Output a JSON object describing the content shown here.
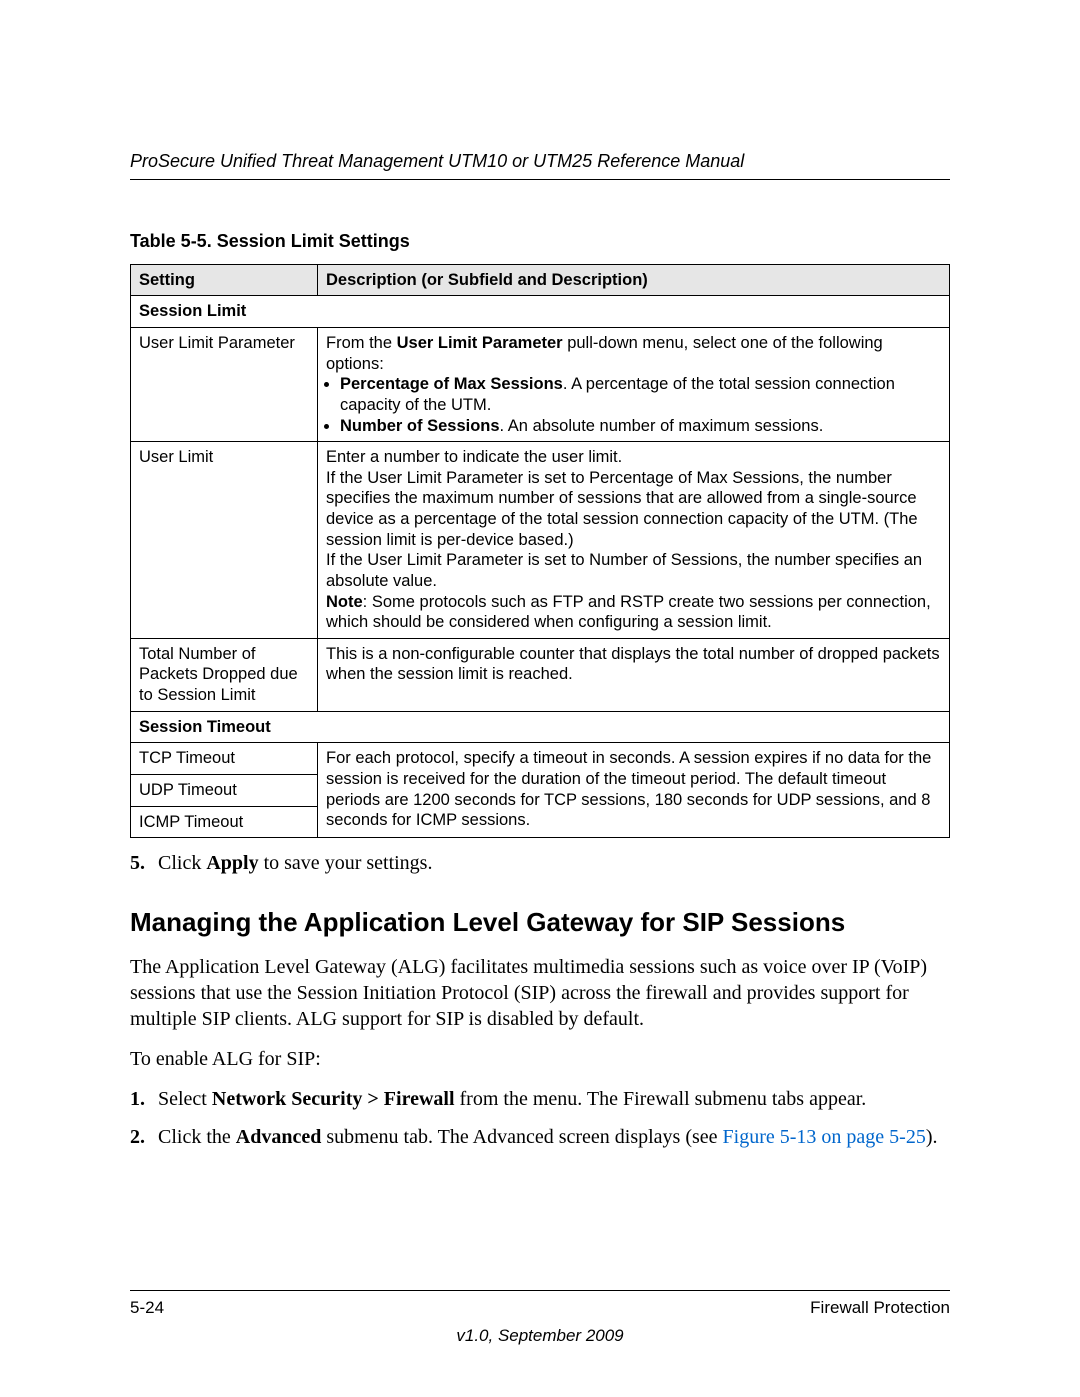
{
  "header": {
    "running_head": "ProSecure Unified Threat Management UTM10 or UTM25 Reference Manual"
  },
  "table": {
    "caption": "Table 5-5. Session Limit Settings",
    "col_setting": "Setting",
    "col_desc": "Description (or Subfield and Description)",
    "section1": "Session Limit",
    "row1_setting": "User Limit Parameter",
    "row1_desc_intro_1": "From the ",
    "row1_desc_intro_bold": "User Limit Parameter",
    "row1_desc_intro_2": " pull-down menu, select one of the following options:",
    "row1_b1_bold": "Percentage of Max Sessions",
    "row1_b1_rest": ". A percentage of the total session connection capacity of the UTM.",
    "row1_b2_bold": "Number of Sessions",
    "row1_b2_rest": ". An absolute number of maximum sessions.",
    "row2_setting": "User Limit",
    "row2_l1": "Enter a number to indicate the user limit.",
    "row2_l2": "If the User Limit Parameter is set to Percentage of Max Sessions, the number specifies the maximum number of sessions that are allowed from a single-source device as a percentage of the total session connection capacity of the UTM. (The session limit is per-device based.)",
    "row2_l3": "If the User Limit Parameter is set to Number of Sessions, the number specifies an absolute value.",
    "row2_l4_bold": "Note",
    "row2_l4_rest": ": Some protocols such as FTP and RSTP create two sessions per connection, which should be considered when configuring a session limit.",
    "row3_setting": "Total Number of Packets Dropped due to Session Limit",
    "row3_desc": "This is a non-configurable counter that displays the total number of dropped packets when the session limit is reached.",
    "section2": "Session Timeout",
    "row4_setting": "TCP Timeout",
    "row5_setting": "UDP Timeout",
    "row6_setting": "ICMP Timeout",
    "timeout_desc": "For each protocol, specify a timeout in seconds. A session expires if no data for the session is received for the duration of the timeout period. The default timeout periods are 1200 seconds for TCP sessions, 180 seconds for UDP sessions, and 8 seconds for ICMP sessions."
  },
  "steps_after_table": {
    "s5_num": "5.",
    "s5_text_1": "Click ",
    "s5_bold": "Apply",
    "s5_text_2": " to save your settings."
  },
  "section": {
    "heading": "Managing the Application Level Gateway for SIP Sessions",
    "p1": "The Application Level Gateway (ALG) facilitates multimedia sessions such as voice over IP (VoIP) sessions that use the Session Initiation Protocol (SIP) across the firewall and provides support for multiple SIP clients. ALG support for SIP is disabled by default.",
    "p2": "To enable ALG for SIP:",
    "s1_num": "1.",
    "s1_a": "Select ",
    "s1_bold": "Network Security > Firewall",
    "s1_b": " from the menu. The Firewall submenu tabs appear.",
    "s2_num": "2.",
    "s2_a": "Click the ",
    "s2_bold": "Advanced",
    "s2_b": " submenu tab. The Advanced screen displays (see ",
    "s2_link": "Figure 5-13 on page 5-25",
    "s2_c": ")."
  },
  "footer": {
    "page": "5-24",
    "title": "Firewall Protection",
    "version": "v1.0, September 2009"
  }
}
